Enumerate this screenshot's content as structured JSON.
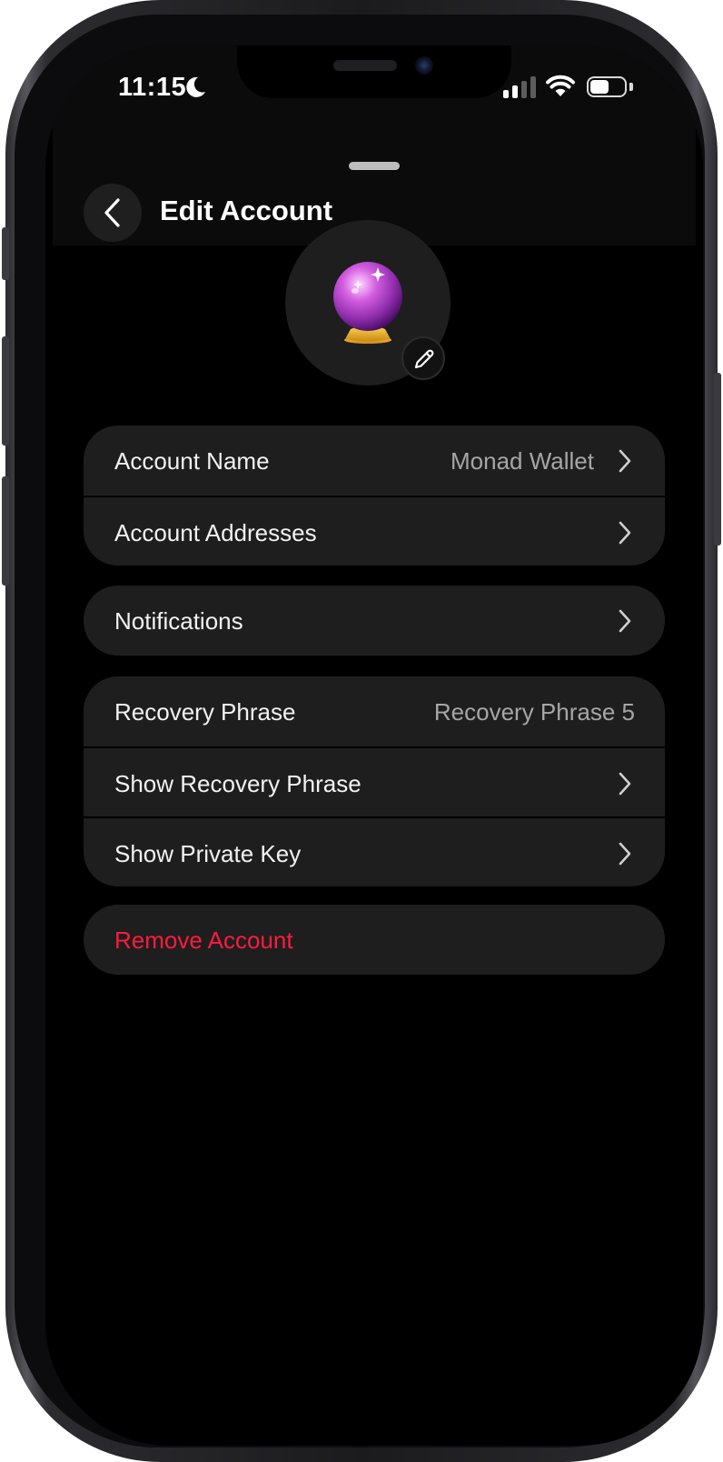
{
  "status_bar": {
    "time": "11:15",
    "battery_level": 0.55
  },
  "header": {
    "title": "Edit Account",
    "back_icon": "chevron-left-icon"
  },
  "avatar": {
    "emoji": "crystal-ball",
    "edit_icon": "pencil-icon"
  },
  "groups": {
    "account": {
      "name_label": "Account Name",
      "name_value": "Monad Wallet",
      "addresses_label": "Account Addresses"
    },
    "notifications": {
      "label": "Notifications"
    },
    "security": {
      "recovery_label": "Recovery Phrase",
      "recovery_value": "Recovery Phrase 5",
      "show_recovery_label": "Show Recovery Phrase",
      "show_private_key_label": "Show Private Key"
    },
    "danger": {
      "remove_label": "Remove Account"
    }
  },
  "colors": {
    "background": "#000000",
    "card": "#1e1e1e",
    "primary_text": "#f2f2f2",
    "secondary_text": "#a6a6a6",
    "danger": "#ff1b3d"
  }
}
